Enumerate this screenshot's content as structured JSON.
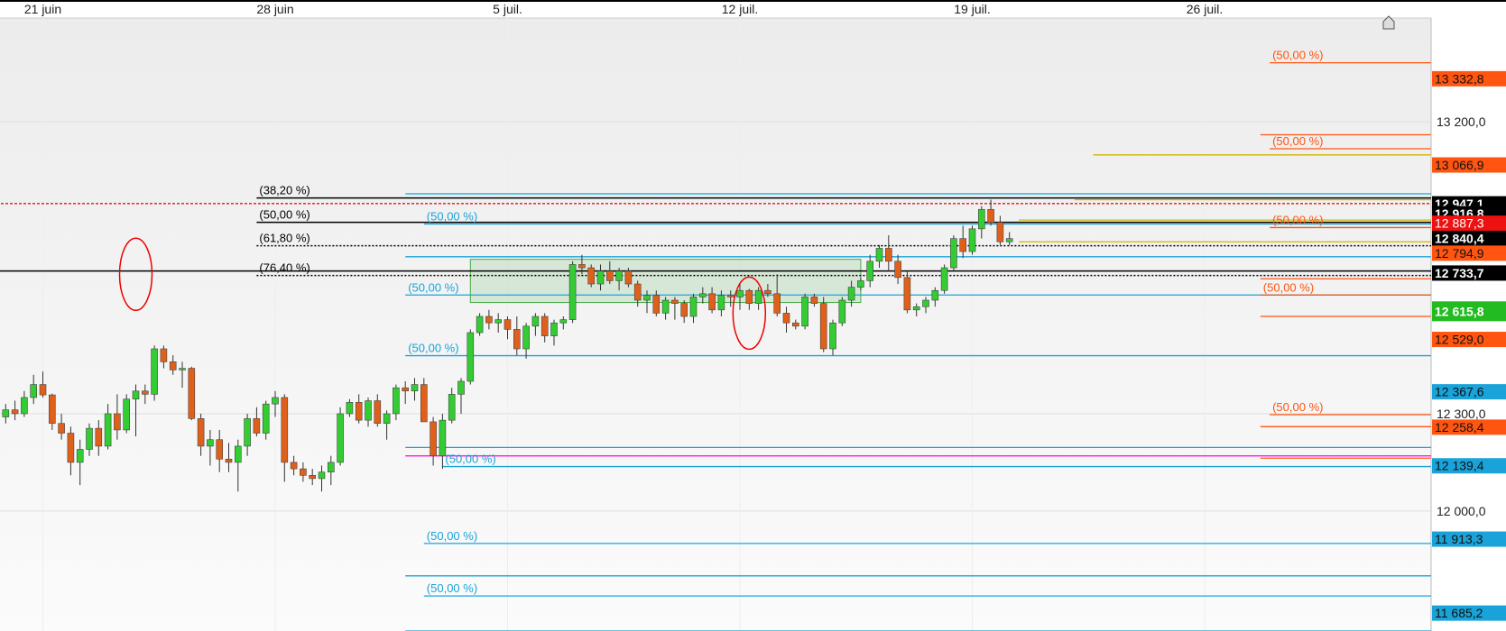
{
  "colors": {
    "up": "#33cc33",
    "down": "#e0601a",
    "cyan": "#1aa3d9",
    "orange": "#ff5511",
    "yellow": "#d4b400",
    "magenta": "#ff00dd",
    "black": "#000000",
    "grid": "#dddddd"
  },
  "home_icon": "house-icon",
  "chart_data": {
    "type": "candlestick",
    "x_labels": [
      {
        "label": "21 juin",
        "index": 5
      },
      {
        "label": "28 juin",
        "index": 30
      },
      {
        "label": "5 juil.",
        "index": 55
      },
      {
        "label": "12 juil.",
        "index": 80
      },
      {
        "label": "19 juil.",
        "index": 105
      },
      {
        "label": "26 juil.",
        "index": 130
      }
    ],
    "y_ticks": [
      13200.0,
      12300.0,
      12000.0
    ],
    "y_tick_labels": [
      "13 200,0",
      "12 300,0",
      "12 000,0"
    ],
    "ylim": [
      11630,
      13520
    ],
    "candles": [
      [
        12298,
        12320,
        12262,
        12290
      ],
      [
        12290,
        12330,
        12270,
        12312
      ],
      [
        12312,
        12340,
        12280,
        12300
      ],
      [
        12300,
        12370,
        12290,
        12350
      ],
      [
        12350,
        12420,
        12330,
        12390
      ],
      [
        12390,
        12430,
        12350,
        12358
      ],
      [
        12358,
        12362,
        12250,
        12270
      ],
      [
        12270,
        12300,
        12220,
        12240
      ],
      [
        12240,
        12260,
        12110,
        12150
      ],
      [
        12150,
        12220,
        12080,
        12190
      ],
      [
        12190,
        12270,
        12170,
        12255
      ],
      [
        12255,
        12280,
        12170,
        12200
      ],
      [
        12200,
        12330,
        12190,
        12300
      ],
      [
        12300,
        12360,
        12220,
        12250
      ],
      [
        12250,
        12360,
        12240,
        12345
      ],
      [
        12345,
        12390,
        12230,
        12370
      ],
      [
        12370,
        12390,
        12330,
        12360
      ],
      [
        12360,
        12510,
        12340,
        12500
      ],
      [
        12500,
        12510,
        12440,
        12460
      ],
      [
        12460,
        12480,
        12420,
        12435
      ],
      [
        12435,
        12460,
        12380,
        12440
      ],
      [
        12440,
        12445,
        12280,
        12285
      ],
      [
        12285,
        12300,
        12170,
        12200
      ],
      [
        12200,
        12250,
        12140,
        12220
      ],
      [
        12220,
        12250,
        12120,
        12160
      ],
      [
        12160,
        12210,
        12120,
        12150
      ],
      [
        12150,
        12220,
        12060,
        12200
      ],
      [
        12200,
        12300,
        12170,
        12285
      ],
      [
        12285,
        12320,
        12230,
        12240
      ],
      [
        12240,
        12340,
        12220,
        12330
      ],
      [
        12330,
        12370,
        12290,
        12350
      ],
      [
        12350,
        12360,
        12090,
        12150
      ],
      [
        12150,
        12170,
        12110,
        12130
      ],
      [
        12130,
        12150,
        12090,
        12110
      ],
      [
        12110,
        12130,
        12080,
        12100
      ],
      [
        12100,
        12140,
        12060,
        12120
      ],
      [
        12120,
        12170,
        12080,
        12150
      ],
      [
        12150,
        12320,
        12140,
        12300
      ],
      [
        12300,
        12345,
        12290,
        12335
      ],
      [
        12335,
        12360,
        12270,
        12280
      ],
      [
        12280,
        12350,
        12260,
        12340
      ],
      [
        12340,
        12360,
        12260,
        12270
      ],
      [
        12270,
        12310,
        12220,
        12300
      ],
      [
        12300,
        12390,
        12280,
        12380
      ],
      [
        12380,
        12400,
        12330,
        12370
      ],
      [
        12370,
        12410,
        12340,
        12390
      ],
      [
        12390,
        12410,
        12360,
        12275
      ],
      [
        12275,
        12290,
        12140,
        12170
      ],
      [
        12170,
        12300,
        12130,
        12280
      ],
      [
        12280,
        12380,
        12270,
        12360
      ],
      [
        12360,
        12410,
        12300,
        12400
      ],
      [
        12400,
        12560,
        12390,
        12550
      ],
      [
        12550,
        12610,
        12540,
        12600
      ],
      [
        12600,
        12620,
        12560,
        12580
      ],
      [
        12580,
        12610,
        12550,
        12590
      ],
      [
        12590,
        12600,
        12530,
        12560
      ],
      [
        12560,
        12600,
        12480,
        12500
      ],
      [
        12500,
        12580,
        12470,
        12570
      ],
      [
        12570,
        12610,
        12540,
        12600
      ],
      [
        12600,
        12610,
        12520,
        12540
      ],
      [
        12540,
        12590,
        12510,
        12580
      ],
      [
        12580,
        12600,
        12560,
        12590
      ],
      [
        12590,
        12770,
        12580,
        12760
      ],
      [
        12760,
        12790,
        12730,
        12750
      ],
      [
        12750,
        12760,
        12690,
        12700
      ],
      [
        12700,
        12760,
        12680,
        12740
      ],
      [
        12740,
        12770,
        12700,
        12710
      ],
      [
        12710,
        12750,
        12680,
        12740
      ],
      [
        12740,
        12750,
        12690,
        12700
      ],
      [
        12700,
        12710,
        12630,
        12650
      ],
      [
        12650,
        12680,
        12610,
        12665
      ],
      [
        12665,
        12680,
        12600,
        12610
      ],
      [
        12610,
        12660,
        12590,
        12650
      ],
      [
        12650,
        12660,
        12590,
        12640
      ],
      [
        12640,
        12650,
        12580,
        12600
      ],
      [
        12600,
        12670,
        12580,
        12660
      ],
      [
        12660,
        12690,
        12640,
        12670
      ],
      [
        12670,
        12690,
        12610,
        12620
      ],
      [
        12620,
        12680,
        12600,
        12665
      ],
      [
        12665,
        12680,
        12630,
        12660
      ],
      [
        12660,
        12700,
        12620,
        12680
      ],
      [
        12680,
        12685,
        12620,
        12640
      ],
      [
        12640,
        12690,
        12620,
        12680
      ],
      [
        12680,
        12700,
        12660,
        12670
      ],
      [
        12670,
        12730,
        12600,
        12610
      ],
      [
        12610,
        12630,
        12550,
        12580
      ],
      [
        12580,
        12590,
        12560,
        12570
      ],
      [
        12570,
        12670,
        12560,
        12660
      ],
      [
        12660,
        12670,
        12630,
        12640
      ],
      [
        12640,
        12660,
        12490,
        12500
      ],
      [
        12500,
        12590,
        12480,
        12580
      ],
      [
        12580,
        12660,
        12570,
        12650
      ],
      [
        12650,
        12710,
        12630,
        12690
      ],
      [
        12690,
        12720,
        12680,
        12710
      ],
      [
        12710,
        12790,
        12690,
        12770
      ],
      [
        12770,
        12820,
        12750,
        12810
      ],
      [
        12810,
        12850,
        12740,
        12770
      ],
      [
        12770,
        12790,
        12700,
        12720
      ],
      [
        12720,
        12740,
        12610,
        12620
      ],
      [
        12620,
        12640,
        12600,
        12630
      ],
      [
        12630,
        12660,
        12610,
        12650
      ],
      [
        12650,
        12690,
        12630,
        12680
      ],
      [
        12680,
        12760,
        12670,
        12750
      ],
      [
        12750,
        12850,
        12740,
        12840
      ],
      [
        12840,
        12880,
        12780,
        12800
      ],
      [
        12800,
        12880,
        12790,
        12870
      ],
      [
        12870,
        12940,
        12840,
        12930
      ],
      [
        12930,
        12960,
        12880,
        12890
      ],
      [
        12890,
        12910,
        12820,
        12830
      ],
      [
        12830,
        12860,
        12820,
        12840
      ]
    ],
    "zones": [
      {
        "type": "rectangle",
        "x": [
          51,
          93
        ],
        "y": [
          12643,
          12776
        ]
      }
    ],
    "levels": [
      {
        "value": 12965,
        "color": "black",
        "start": 28,
        "label": "(38,20 %)",
        "style": "solid"
      },
      {
        "value": 12890,
        "color": "black",
        "start": 28,
        "label": "(50,00 %)",
        "style": "solid"
      },
      {
        "value": 12818,
        "color": "black",
        "start": 28,
        "label": "(61,80 %)",
        "style": "dotted"
      },
      {
        "value": 12726,
        "color": "black",
        "start": 28,
        "label": "(76,40 %)",
        "style": "dotted"
      },
      {
        "value": 12740,
        "color": "black",
        "start": 0,
        "label": "",
        "style": "solid"
      },
      {
        "value": 12948,
        "color": "red",
        "start": 0,
        "label": "",
        "style": "dashed"
      },
      {
        "value": 12978,
        "color": "cyan",
        "start": 44,
        "label": "",
        "style": "solid"
      },
      {
        "value": 12885,
        "color": "cyan",
        "start": 46,
        "label": "(50,00 %)",
        "style": "solid"
      },
      {
        "value": 12784,
        "color": "cyan",
        "start": 44,
        "label": "",
        "style": "solid"
      },
      {
        "value": 12666,
        "color": "cyan",
        "start": 44,
        "label": "(50,00 %)",
        "style": "solid"
      },
      {
        "value": 12479,
        "color": "cyan",
        "start": 44,
        "label": "(50,00 %)",
        "style": "solid"
      },
      {
        "value": 12196,
        "color": "cyan",
        "start": 44,
        "label": "",
        "style": "solid"
      },
      {
        "value": 12137,
        "color": "cyan",
        "start": 48,
        "label": "(50,00 %)",
        "style": "solid"
      },
      {
        "value": 11900,
        "color": "cyan",
        "start": 46,
        "label": "(50,00 %)",
        "style": "solid"
      },
      {
        "value": 11800,
        "color": "cyan",
        "start": 44,
        "label": "",
        "style": "solid"
      },
      {
        "value": 11738,
        "color": "cyan",
        "start": 46,
        "label": "(50,00 %)",
        "style": "solid"
      },
      {
        "value": 11630,
        "color": "cyan",
        "start": 44,
        "label": "",
        "style": "solid"
      },
      {
        "value": 13382,
        "color": "orange",
        "start": 137,
        "label": "(50,00 %)",
        "style": "solid"
      },
      {
        "value": 13160,
        "color": "orange",
        "start": 136,
        "label": "",
        "style": "solid"
      },
      {
        "value": 13117,
        "color": "orange",
        "start": 137,
        "label": "(50,00 %)",
        "style": "solid"
      },
      {
        "value": 12874,
        "color": "orange",
        "start": 137,
        "label": "(50,00 %)",
        "style": "solid"
      },
      {
        "value": 12716,
        "color": "orange",
        "start": 136,
        "label": "",
        "style": "solid"
      },
      {
        "value": 12666,
        "color": "orange",
        "start": 136,
        "label": "(50,00 %)",
        "style": "solid"
      },
      {
        "value": 12600,
        "color": "orange",
        "start": 136,
        "label": "",
        "style": "solid"
      },
      {
        "value": 12297,
        "color": "orange",
        "start": 137,
        "label": "(50,00 %)",
        "style": "solid"
      },
      {
        "value": 12260,
        "color": "orange",
        "start": 136,
        "label": "",
        "style": "solid"
      },
      {
        "value": 12163,
        "color": "orange",
        "start": 136,
        "label": "",
        "style": "solid"
      },
      {
        "value": 13098,
        "color": "yellow",
        "start": 118,
        "label": "",
        "style": "solid"
      },
      {
        "value": 12960,
        "color": "yellow",
        "start": 116,
        "label": "",
        "style": "solid"
      },
      {
        "value": 12897,
        "color": "yellow",
        "start": 110,
        "label": "",
        "style": "solid"
      },
      {
        "value": 12830,
        "color": "yellow",
        "start": 110,
        "label": "",
        "style": "solid"
      },
      {
        "value": 12170,
        "color": "magenta",
        "start": 44,
        "label": "",
        "style": "solid"
      }
    ],
    "ellipses": [
      {
        "x": 15,
        "y": 12730,
        "label": ""
      },
      {
        "x": 81,
        "y": 12610,
        "label": ""
      }
    ],
    "price_tags": [
      {
        "label": "13 332,8",
        "color": "orange"
      },
      {
        "label": "13 066,9",
        "color": "orange"
      },
      {
        "label": "12 947,1",
        "color": "black"
      },
      {
        "label": "12 916,8",
        "color": "black"
      },
      {
        "label": "12 887,3",
        "color": "red"
      },
      {
        "label": "12 840,4",
        "color": "black"
      },
      {
        "label": "12 794,9",
        "color": "orange"
      },
      {
        "label": "12 733,7",
        "color": "black"
      },
      {
        "label": "12 615,8",
        "color": "green"
      },
      {
        "label": "12 529,0",
        "color": "orange"
      },
      {
        "label": "12 367,6",
        "color": "cyan"
      },
      {
        "label": "12 258,4",
        "color": "orange"
      },
      {
        "label": "12 139,4",
        "color": "cyan"
      },
      {
        "label": "11 913,3",
        "color": "cyan"
      },
      {
        "label": "11 685,2",
        "color": "cyan"
      }
    ]
  }
}
